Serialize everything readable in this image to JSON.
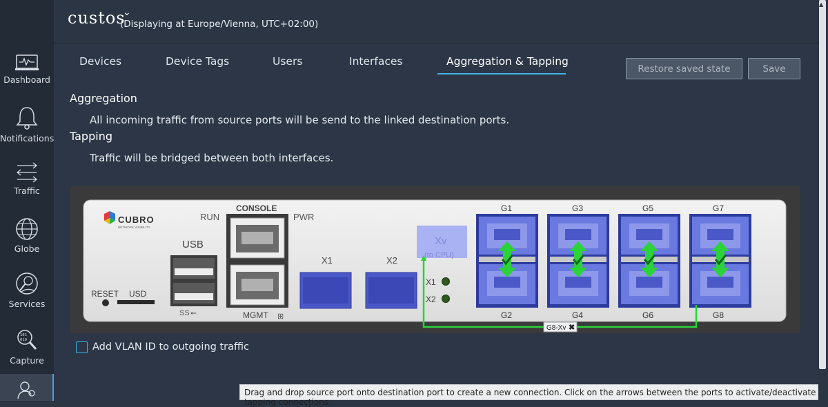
{
  "app": {
    "logo_text": "custos",
    "timezone_text": "(Displaying at Europe/Vienna, UTC+02:00)"
  },
  "sidebar": {
    "items": [
      {
        "label": "Dashboard",
        "icon": "dashboard-icon"
      },
      {
        "label": "Notifications",
        "icon": "bell-icon"
      },
      {
        "label": "Traffic",
        "icon": "traffic-arrows-icon"
      },
      {
        "label": "Globe",
        "icon": "globe-icon"
      },
      {
        "label": "Services",
        "icon": "services-gear-icon"
      },
      {
        "label": "Capture",
        "icon": "capture-magnifier-icon"
      },
      {
        "label": "",
        "icon": "users-icon"
      }
    ]
  },
  "tabs": [
    {
      "label": "Devices"
    },
    {
      "label": "Device Tags"
    },
    {
      "label": "Users"
    },
    {
      "label": "Interfaces"
    },
    {
      "label": "Aggregation & Tapping",
      "active": true
    }
  ],
  "buttons": {
    "restore": "Restore saved state",
    "save": "Save"
  },
  "content": {
    "aggregation_title": "Aggregation",
    "aggregation_text": "All incoming traffic from source ports will be send to the linked destination ports.",
    "tapping_title": "Tapping",
    "tapping_text": "Traffic will be bridged between both interfaces."
  },
  "device": {
    "brand": "CUBRO",
    "brand_sub": "NETWORK VISIBILITY",
    "labels": {
      "run": "RUN",
      "console": "CONSOLE",
      "pwr": "PWR",
      "usb": "USB",
      "ss": "SS",
      "reset": "RESET",
      "usd": "USD",
      "mgmt": "MGMT",
      "x1": "X1",
      "x2": "X2",
      "xv": "Xv",
      "xv_sub": "(to CPU)",
      "led_x1": "X1",
      "led_x2": "X2"
    },
    "top_ports": [
      "G1",
      "G3",
      "G5",
      "G7"
    ],
    "bottom_ports": [
      "G2",
      "G4",
      "G6",
      "G8"
    ],
    "connection_label": "G8-Xv",
    "colors": {
      "port": "#6a79e0",
      "tap": "#2bd23a",
      "xv": "#a9b2f2"
    }
  },
  "vlan": {
    "label": "Add VLAN ID to outgoing traffic",
    "checked": false
  },
  "hint": "Drag and drop source port onto destination port to create a new connection. Click on the arrows between the ports to activate/deactivate tapping connections."
}
